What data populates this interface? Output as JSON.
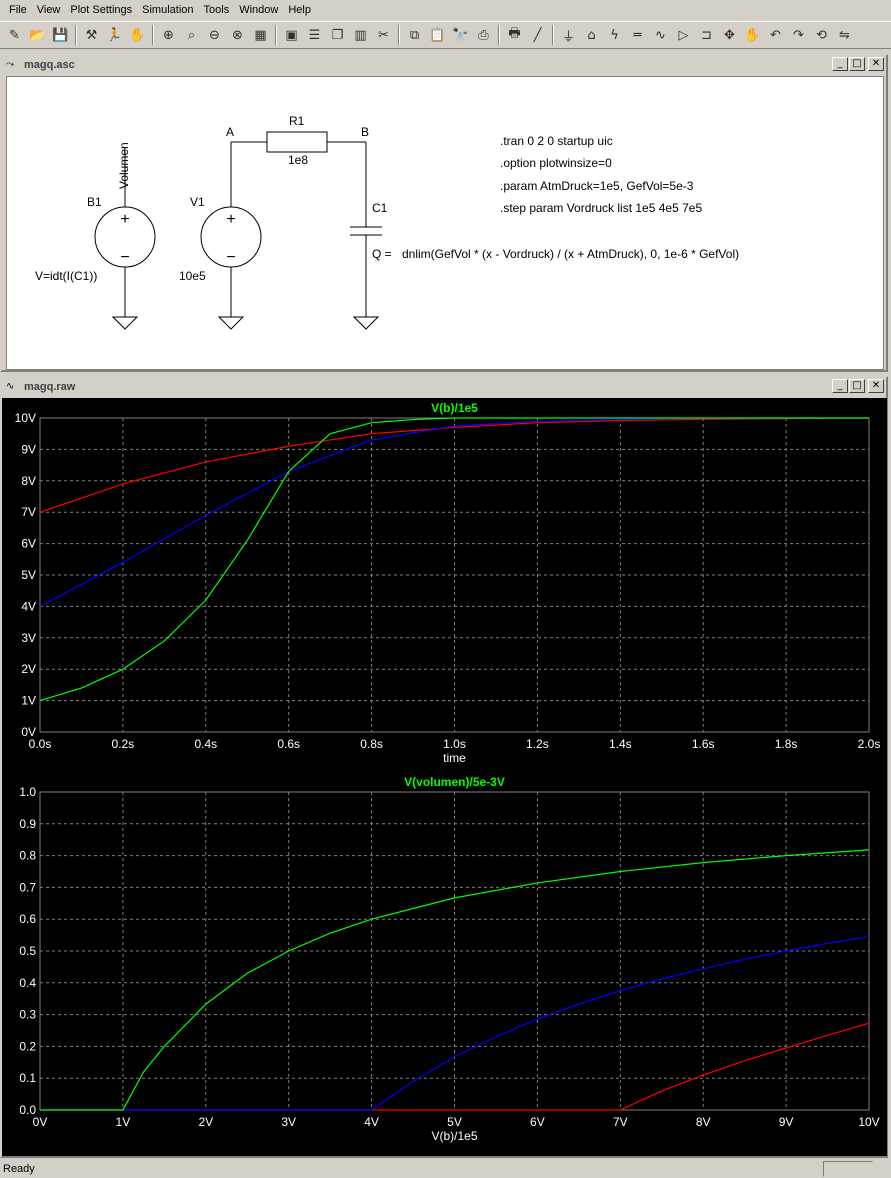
{
  "menu": [
    "File",
    "View",
    "Plot Settings",
    "Simulation",
    "Tools",
    "Window",
    "Help"
  ],
  "toolbar_icons": [
    "new-schematic-icon",
    "open-icon",
    "save-icon",
    "hammer-icon",
    "run-icon",
    "halt-icon",
    "zoom-in-icon",
    "zoom-pan-icon",
    "zoom-out-icon",
    "zoom-cancel-icon",
    "autorange-icon",
    "mark-icon",
    "tile-horizontal-icon",
    "cascade-icon",
    "tile-vertical-icon",
    "cut-icon",
    "copy-icon",
    "paste-icon",
    "find-icon",
    "print-setup-icon",
    "print-icon",
    "wire-icon",
    "ground-icon",
    "label-icon",
    "resistor-icon",
    "capacitor-icon",
    "inductor-icon",
    "diode-icon",
    "component-icon",
    "move-icon",
    "drag-icon",
    "undo-icon",
    "redo-icon",
    "rotate-icon",
    "mirror-icon"
  ],
  "schematic_window": {
    "title": "magq.asc",
    "labels": {
      "b1": "B1",
      "b1_net": "Volumen",
      "b1_expr": "V=idt(I(C1))",
      "v1": "V1",
      "v1_value": "10e5",
      "node_a": "A",
      "node_b": "B",
      "r1": "R1",
      "r1_value": "1e8",
      "c1": "C1",
      "c1_expr_lhs": "Q =",
      "c1_expr": "dnlim(GefVol * (x - Vordruck) / (x + AtmDruck), 0, 1e-6 * GefVol)"
    },
    "directives": [
      ".tran 0 2 0 startup uic",
      ".option plotwinsize=0",
      ".param AtmDruck=1e5, GefVol=5e-3",
      ".step param Vordruck list 1e5 4e5 7e5"
    ]
  },
  "plot_window": {
    "title": "magq.raw"
  },
  "chart_data": [
    {
      "type": "line",
      "title": "V(b)/1e5",
      "xlabel": "time",
      "ylabel": "",
      "xlim": [
        0,
        2
      ],
      "ylim": [
        0,
        10
      ],
      "x_ticks": [
        "0.0s",
        "0.2s",
        "0.4s",
        "0.6s",
        "0.8s",
        "1.0s",
        "1.2s",
        "1.4s",
        "1.6s",
        "1.8s",
        "2.0s"
      ],
      "y_ticks": [
        "0V",
        "1V",
        "2V",
        "3V",
        "4V",
        "5V",
        "6V",
        "7V",
        "8V",
        "9V",
        "10V"
      ],
      "grid": true,
      "series": [
        {
          "color": "#ff0000",
          "x": [
            0,
            0.2,
            0.4,
            0.6,
            0.8,
            1.0,
            1.2,
            1.4,
            1.6,
            1.8,
            2.0
          ],
          "y": [
            7.0,
            7.9,
            8.6,
            9.1,
            9.5,
            9.7,
            9.85,
            9.92,
            9.96,
            9.98,
            10.0
          ]
        },
        {
          "color": "#0000ff",
          "x": [
            0,
            0.2,
            0.4,
            0.6,
            0.8,
            1.0,
            1.2,
            1.4,
            1.6,
            1.8,
            2.0
          ],
          "y": [
            4.0,
            5.4,
            6.9,
            8.3,
            9.3,
            9.75,
            9.9,
            9.96,
            9.99,
            10.0,
            10.0
          ]
        },
        {
          "color": "#00ff00",
          "x": [
            0,
            0.1,
            0.2,
            0.3,
            0.4,
            0.5,
            0.6,
            0.7,
            0.8,
            0.9,
            1.0,
            1.2,
            1.4,
            1.6,
            1.8,
            2.0
          ],
          "y": [
            1.0,
            1.4,
            2.0,
            2.9,
            4.2,
            6.1,
            8.3,
            9.5,
            9.85,
            9.95,
            10.0,
            10.0,
            10.0,
            10.0,
            10.0,
            10.0
          ]
        }
      ]
    },
    {
      "type": "line",
      "title": "V(volumen)/5e-3V",
      "xlabel": "V(b)/1e5",
      "ylabel": "",
      "xlim": [
        0,
        10
      ],
      "ylim": [
        0,
        1
      ],
      "x_ticks": [
        "0V",
        "1V",
        "2V",
        "3V",
        "4V",
        "5V",
        "6V",
        "7V",
        "8V",
        "9V",
        "10V"
      ],
      "y_ticks": [
        "0.0",
        "0.1",
        "0.2",
        "0.3",
        "0.4",
        "0.5",
        "0.6",
        "0.7",
        "0.8",
        "0.9",
        "1.0"
      ],
      "grid": true,
      "series": [
        {
          "color": "#ff0000",
          "x": [
            0,
            7,
            7.5,
            8,
            8.5,
            9,
            9.5,
            10
          ],
          "y": [
            0,
            0,
            0.06,
            0.11,
            0.155,
            0.195,
            0.235,
            0.273
          ]
        },
        {
          "color": "#0000ff",
          "x": [
            0,
            4,
            4.5,
            5,
            5.5,
            6,
            6.5,
            7,
            7.5,
            8,
            8.5,
            9,
            9.5,
            10
          ],
          "y": [
            0,
            0,
            0.09,
            0.167,
            0.23,
            0.286,
            0.333,
            0.375,
            0.412,
            0.444,
            0.474,
            0.5,
            0.524,
            0.545
          ]
        },
        {
          "color": "#00ff00",
          "x": [
            0,
            1,
            1.25,
            1.5,
            2,
            2.5,
            3,
            3.5,
            4,
            5,
            6,
            7,
            8,
            9,
            10
          ],
          "y": [
            0,
            0,
            0.12,
            0.2,
            0.333,
            0.43,
            0.5,
            0.556,
            0.6,
            0.667,
            0.714,
            0.75,
            0.778,
            0.8,
            0.818
          ]
        }
      ]
    }
  ],
  "statusbar": {
    "text": "Ready"
  },
  "colors": {
    "background": "#000000",
    "axis": "#ff0000",
    "grid": "#808080",
    "tick_text": "#ffffff",
    "title_text": "#00ff00"
  }
}
